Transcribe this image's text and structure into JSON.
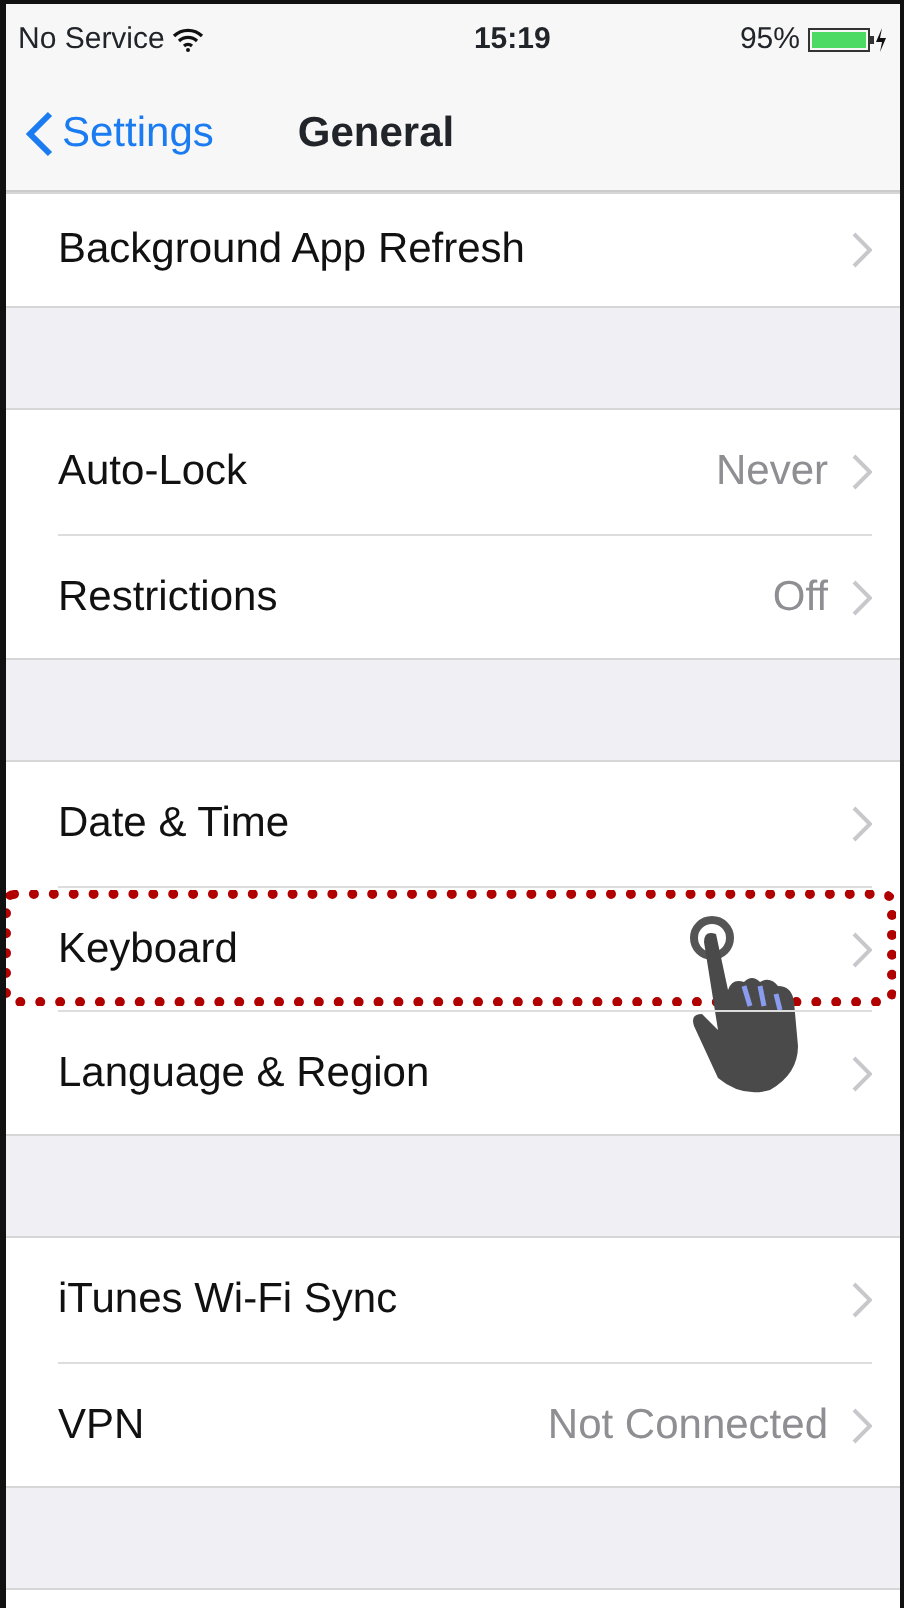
{
  "status_bar": {
    "carrier": "No Service",
    "time": "15:19",
    "battery": "95%"
  },
  "nav_bar": {
    "back": "Settings",
    "title": "General"
  },
  "groups": [
    {
      "rows": [
        {
          "kind": "row",
          "label": "Background App Refresh",
          "highlighted": false
        }
      ]
    },
    {
      "rows": [
        {
          "kind": "row",
          "label": "Auto-Lock",
          "value": "Never",
          "highlighted": false
        },
        {
          "kind": "row",
          "label": "Restrictions",
          "value": "Off",
          "highlighted": false
        }
      ]
    },
    {
      "rows": [
        {
          "kind": "row",
          "label": "Date & Time",
          "highlighted": false
        },
        {
          "kind": "row",
          "label": "Keyboard",
          "highlighted": true
        },
        {
          "kind": "row",
          "label": "Language & Region",
          "highlighted": false
        }
      ]
    },
    {
      "rows": [
        {
          "kind": "row",
          "label": "iTunes Wi-Fi Sync",
          "highlighted": false
        },
        {
          "kind": "row",
          "label": "VPN",
          "value": "Not Connected",
          "highlighted": false
        }
      ]
    },
    {
      "rows": [
        {
          "kind": "clipped"
        }
      ]
    }
  ]
}
